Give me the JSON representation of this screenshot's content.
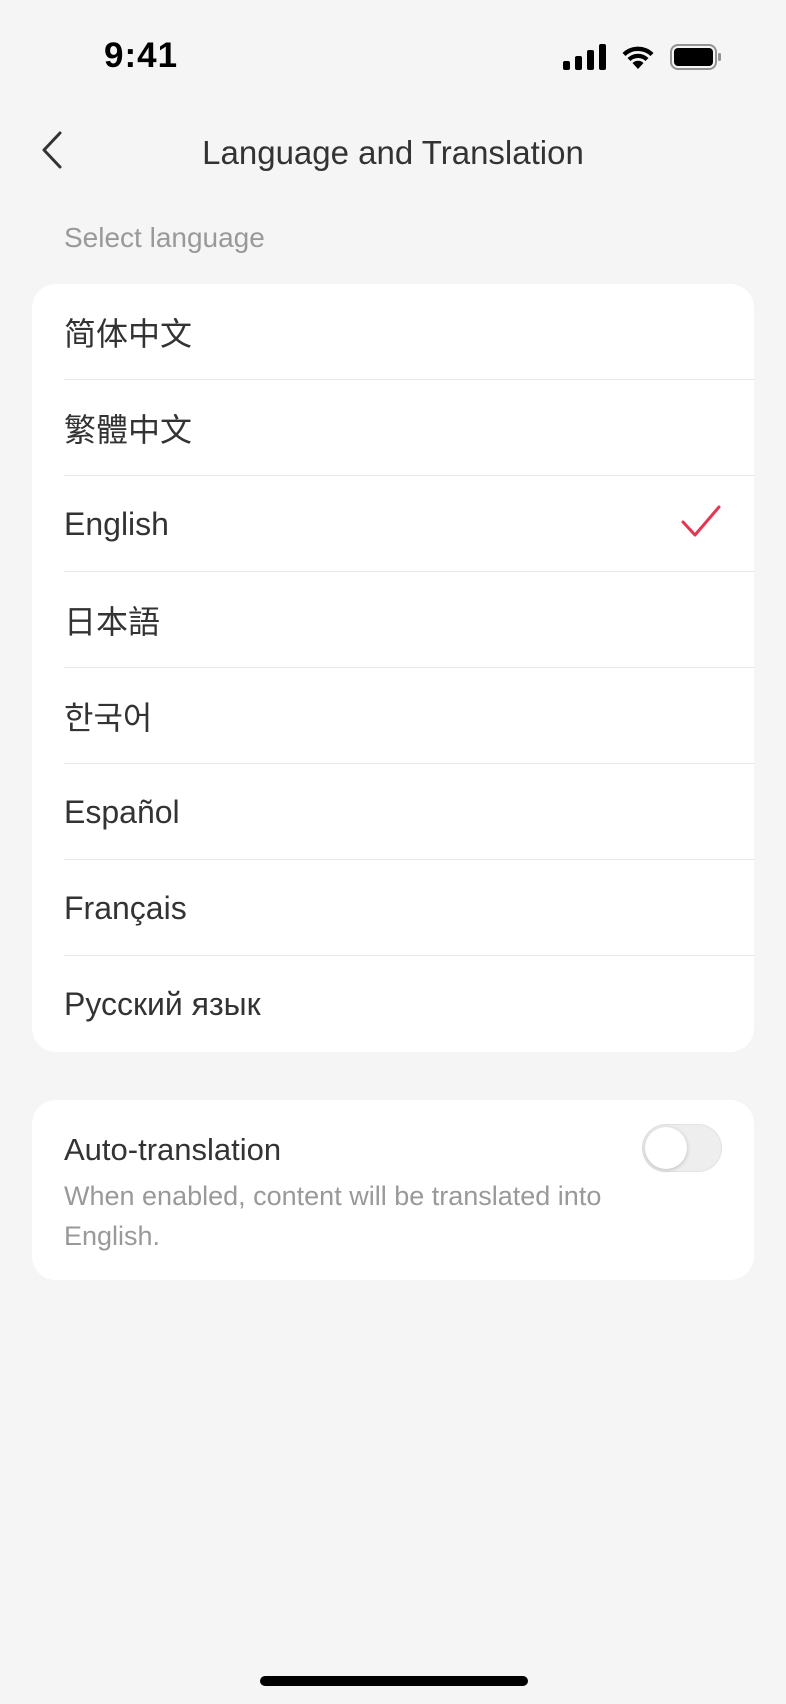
{
  "status_bar": {
    "time": "9:41"
  },
  "nav": {
    "title": "Language and Translation"
  },
  "section": {
    "select_language_label": "Select language"
  },
  "languages": [
    {
      "label": "简体中文",
      "selected": false
    },
    {
      "label": "繁體中文",
      "selected": false
    },
    {
      "label": "English",
      "selected": true
    },
    {
      "label": "日本語",
      "selected": false
    },
    {
      "label": "한국어",
      "selected": false
    },
    {
      "label": "Español",
      "selected": false
    },
    {
      "label": "Français",
      "selected": false
    },
    {
      "label": "Русский язык",
      "selected": false
    }
  ],
  "auto_translation": {
    "title": "Auto-translation",
    "description": "When enabled, content will be translated into English.",
    "enabled": false
  },
  "colors": {
    "accent_check": "#e8344e",
    "background": "#f5f5f5",
    "card": "#ffffff"
  },
  "icons": {
    "back": "chevron-left-icon",
    "check": "check-icon",
    "signal": "signal-icon",
    "wifi": "wifi-icon",
    "battery": "battery-icon"
  }
}
